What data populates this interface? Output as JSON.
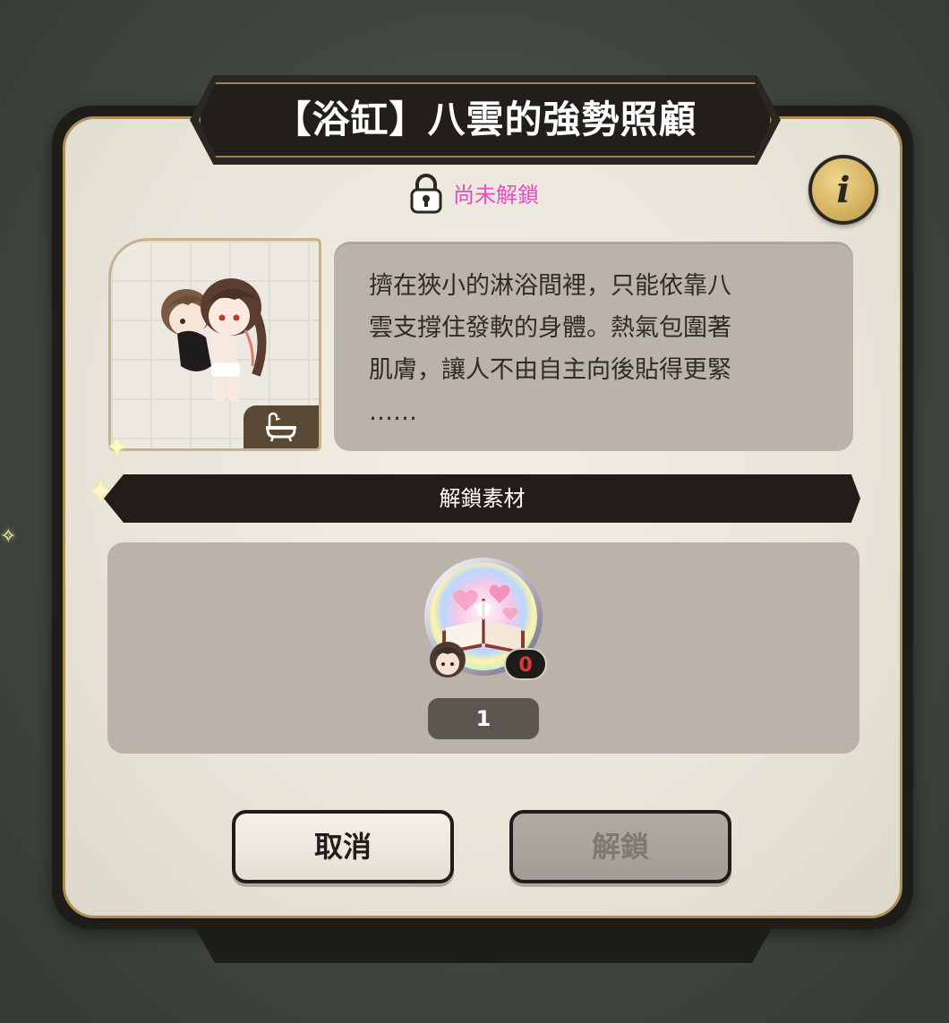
{
  "dialog": {
    "title": "【浴缸】八雲的強勢照顧",
    "status": "尚未解鎖",
    "status_color": "#e54fc6",
    "info_glyph": "i",
    "description": "擠在狹小的淋浴間裡，只能依靠八\n雲支撐住發軟的身體。熱氣包圍著\n肌膚，讓人不由自主向後貼得更緊\n……",
    "thumbnail_badge_icon": "bathtub-icon"
  },
  "materials": {
    "section_title": "解鎖素材",
    "item": {
      "icon": "heart-book-icon",
      "owned": "0",
      "required": "1",
      "owned_color": "#e0392e"
    }
  },
  "buttons": {
    "cancel": "取消",
    "unlock": "解鎖"
  }
}
